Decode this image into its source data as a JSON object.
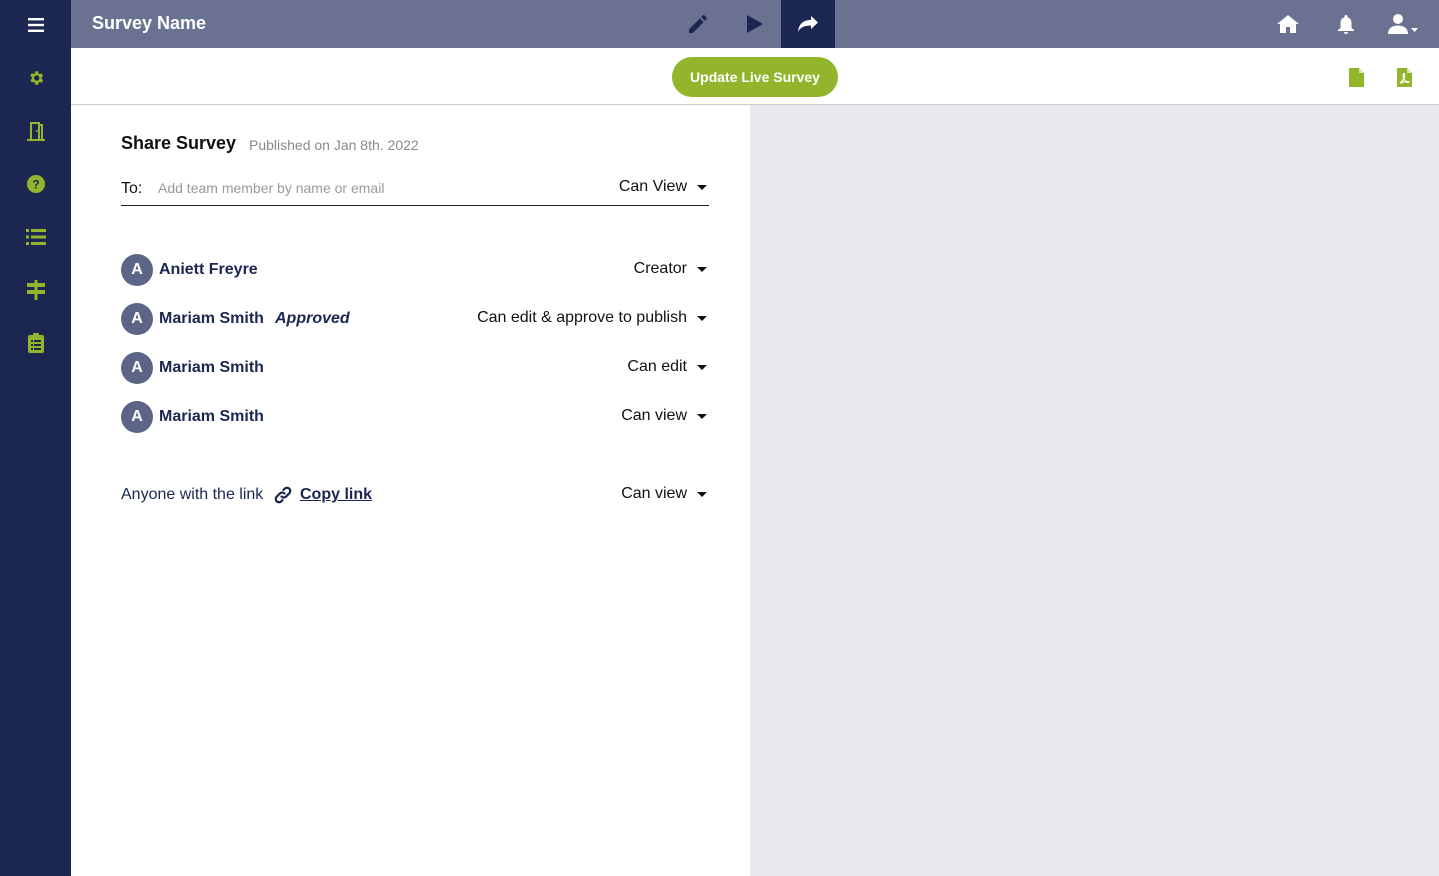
{
  "colors": {
    "sidebar": "#1b2651",
    "topbar": "#6b7190",
    "accent": "#93b52c",
    "avatar": "#5c6585"
  },
  "sidebar": {
    "items": [
      {
        "icon": "menu-icon"
      },
      {
        "icon": "gear-icon"
      },
      {
        "icon": "door-exit-icon"
      },
      {
        "icon": "help-circle-icon"
      },
      {
        "icon": "list-icon"
      },
      {
        "icon": "signpost-icon"
      },
      {
        "icon": "clipboard-icon"
      }
    ]
  },
  "header": {
    "title": "Survey Name",
    "tools": [
      "pencil-icon",
      "play-icon",
      "share-icon"
    ],
    "right_icons": [
      "home-icon",
      "bell-icon",
      "user-menu-icon"
    ]
  },
  "subbar": {
    "update_label": "Update Live Survey",
    "doc_icons": [
      "file-icon",
      "pdf-file-icon"
    ]
  },
  "share": {
    "title": "Share Survey",
    "published": "Published on Jan 8th. 2022",
    "to_label": "To:",
    "to_placeholder": "Add team member by name or email",
    "to_permission": "Can View",
    "members": [
      {
        "initial": "A",
        "name": "Aniett Freyre",
        "status": "",
        "permission": "Creator"
      },
      {
        "initial": "A",
        "name": "Mariam Smith",
        "status": "Approved",
        "permission": "Can edit & approve to publish"
      },
      {
        "initial": "A",
        "name": "Mariam Smith",
        "status": "",
        "permission": "Can edit"
      },
      {
        "initial": "A",
        "name": "Mariam Smith",
        "status": "",
        "permission": "Can view"
      }
    ],
    "link": {
      "label": "Anyone with the link",
      "copy_label": "Copy link",
      "permission": "Can view"
    }
  }
}
